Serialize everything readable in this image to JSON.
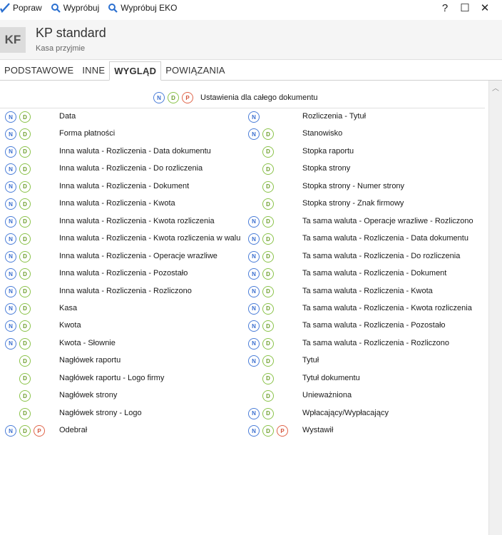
{
  "toolbar": {
    "items": [
      {
        "label": "Popraw",
        "icon": "checkmark-icon"
      },
      {
        "label": "Wypróbuj",
        "icon": "search-icon"
      },
      {
        "label": "Wypróbuj EKO",
        "icon": "search-icon"
      }
    ],
    "window": {
      "help": "?",
      "maximize": "☐",
      "close": "✕"
    }
  },
  "header": {
    "avatar": "KF",
    "title": "KP standard",
    "subtitle": "Kasa przyjmie"
  },
  "tabs": [
    {
      "label": "PODSTAWOWE",
      "active": false
    },
    {
      "label": "INNE",
      "active": false
    },
    {
      "label": "WYGLĄD",
      "active": true
    },
    {
      "label": "POWIĄZANIA",
      "active": false
    }
  ],
  "legend": {
    "badges": [
      "N",
      "D",
      "P"
    ],
    "text": "Ustawienia dla całego dokumentu"
  },
  "left_column": [
    {
      "label": "Data",
      "badges": [
        "N",
        "D"
      ]
    },
    {
      "label": "Forma płatności",
      "badges": [
        "N",
        "D"
      ]
    },
    {
      "label": "Inna waluta - Rozliczenia - Data dokumentu",
      "badges": [
        "N",
        "D"
      ]
    },
    {
      "label": "Inna waluta - Rozliczenia - Do rozliczenia",
      "badges": [
        "N",
        "D"
      ]
    },
    {
      "label": "Inna waluta - Rozliczenia - Dokument",
      "badges": [
        "N",
        "D"
      ]
    },
    {
      "label": "Inna waluta - Rozliczenia - Kwota",
      "badges": [
        "N",
        "D"
      ]
    },
    {
      "label": "Inna waluta - Rozliczenia - Kwota rozliczenia",
      "badges": [
        "N",
        "D"
      ]
    },
    {
      "label": "Inna waluta - Rozliczenia - Kwota rozliczenia w walu",
      "badges": [
        "N",
        "D"
      ]
    },
    {
      "label": "Inna waluta - Rozliczenia - Operacje wrazliwe",
      "badges": [
        "N",
        "D"
      ]
    },
    {
      "label": "Inna waluta - Rozliczenia - Pozostało",
      "badges": [
        "N",
        "D"
      ]
    },
    {
      "label": "Inna waluta - Rozliczenia - Rozliczono",
      "badges": [
        "N",
        "D"
      ]
    },
    {
      "label": "Kasa",
      "badges": [
        "N",
        "D"
      ]
    },
    {
      "label": "Kwota",
      "badges": [
        "N",
        "D"
      ]
    },
    {
      "label": "Kwota - Słownie",
      "badges": [
        "N",
        "D"
      ]
    },
    {
      "label": "Nagłówek raportu",
      "badges": [
        "",
        "D"
      ]
    },
    {
      "label": "Nagłówek raportu - Logo firmy",
      "badges": [
        "",
        "D"
      ]
    },
    {
      "label": "Nagłówek strony",
      "badges": [
        "",
        "D"
      ]
    },
    {
      "label": "Nagłówek strony - Logo",
      "badges": [
        "",
        "D"
      ]
    },
    {
      "label": "Odebrał",
      "badges": [
        "N",
        "D",
        "P"
      ]
    }
  ],
  "right_column": [
    {
      "label": "Rozliczenia - Tytuł",
      "badges": [
        "N"
      ]
    },
    {
      "label": "Stanowisko",
      "badges": [
        "N",
        "D"
      ]
    },
    {
      "label": "Stopka raportu",
      "badges": [
        "",
        "D"
      ]
    },
    {
      "label": "Stopka strony",
      "badges": [
        "",
        "D"
      ]
    },
    {
      "label": "Stopka strony - Numer strony",
      "badges": [
        "",
        "D"
      ]
    },
    {
      "label": "Stopka strony - Znak firmowy",
      "badges": [
        "",
        "D"
      ]
    },
    {
      "label": "Ta sama waluta - Operacje wrazliwe - Rozliczono",
      "badges": [
        "N",
        "D"
      ]
    },
    {
      "label": "Ta sama waluta - Rozliczenia - Data dokumentu",
      "badges": [
        "N",
        "D"
      ]
    },
    {
      "label": "Ta sama waluta - Rozliczenia - Do rozliczenia",
      "badges": [
        "N",
        "D"
      ]
    },
    {
      "label": "Ta sama waluta - Rozliczenia - Dokument",
      "badges": [
        "N",
        "D"
      ]
    },
    {
      "label": "Ta sama waluta - Rozliczenia - Kwota",
      "badges": [
        "N",
        "D"
      ]
    },
    {
      "label": "Ta sama waluta - Rozliczenia - Kwota rozliczenia",
      "badges": [
        "N",
        "D"
      ]
    },
    {
      "label": "Ta sama waluta - Rozliczenia - Pozostało",
      "badges": [
        "N",
        "D"
      ]
    },
    {
      "label": "Ta sama waluta - Rozliczenia - Rozliczono",
      "badges": [
        "N",
        "D"
      ]
    },
    {
      "label": "Tytuł",
      "badges": [
        "N",
        "D"
      ]
    },
    {
      "label": "Tytuł dokumentu",
      "badges": [
        "",
        "D"
      ]
    },
    {
      "label": "Unieważniona",
      "badges": [
        "",
        "D"
      ]
    },
    {
      "label": "Wpłacający/Wypłacający",
      "badges": [
        "N",
        "D"
      ]
    },
    {
      "label": "Wystawił",
      "badges": [
        "N",
        "D",
        "P"
      ]
    }
  ]
}
